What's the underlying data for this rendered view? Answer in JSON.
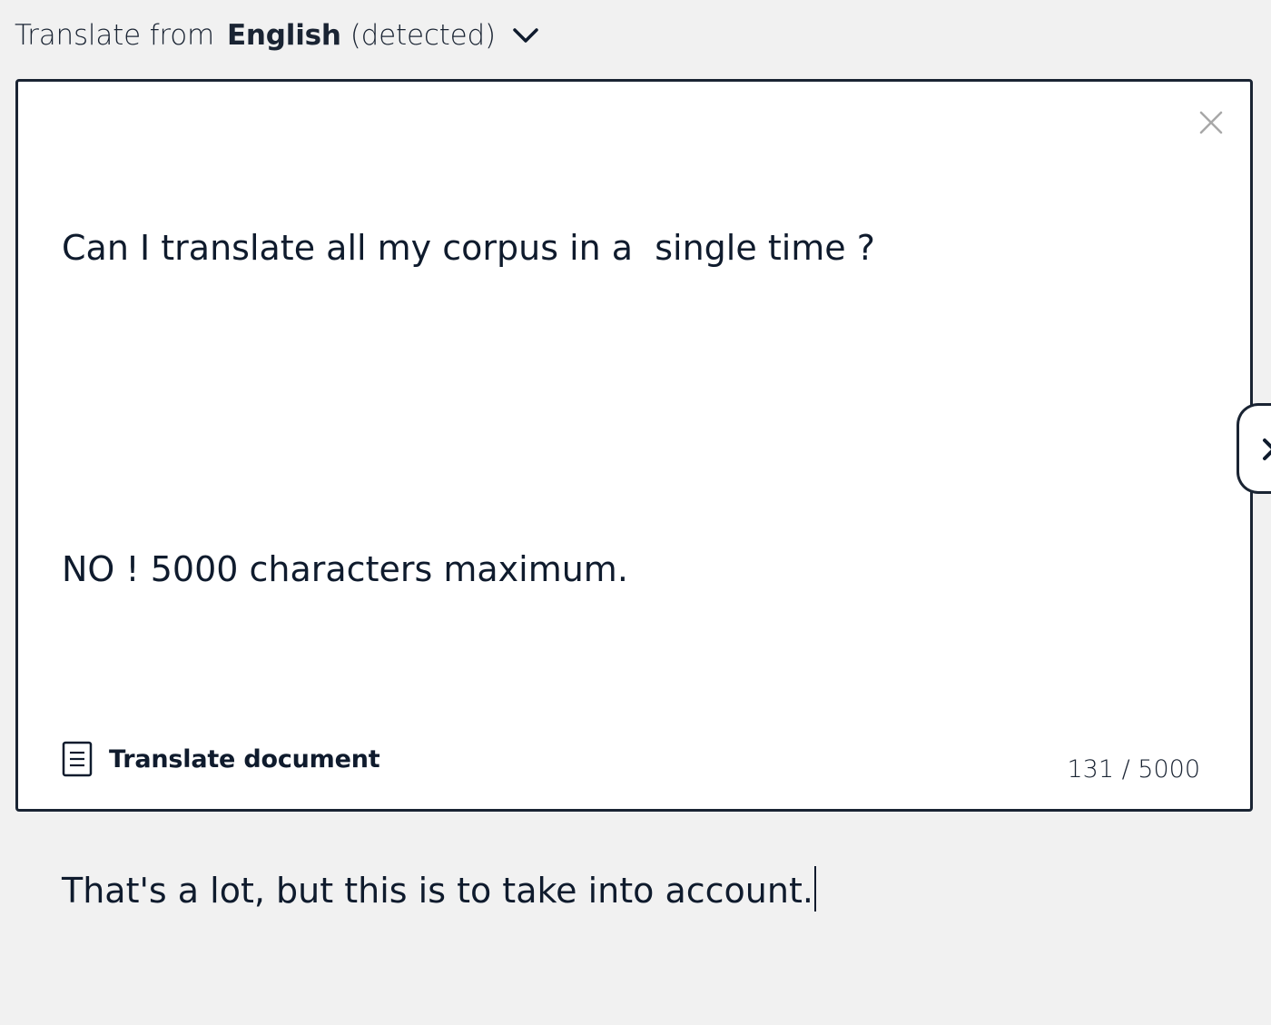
{
  "source_lang": {
    "prefix": "Translate from",
    "language": "English",
    "suffix": "(detected)",
    "dropdown_icon": "chevron-down-icon"
  },
  "editor": {
    "lines": [
      "Can I translate all my corpus in a  single time ?",
      "",
      "NO ! 5000 characters maximum.",
      "",
      "That's a lot, but this is to take into account."
    ],
    "clear_icon": "close-icon"
  },
  "footer": {
    "doc_icon": "document-icon",
    "translate_document_label": "Translate document",
    "char_count": "131 / 5000"
  },
  "side_tab": {
    "icon": "chevron-right-icon"
  },
  "colors": {
    "background": "#f1f1f1",
    "panel": "#ffffff",
    "ink": "#0f1b2d",
    "muted": "#a8a8a8"
  }
}
